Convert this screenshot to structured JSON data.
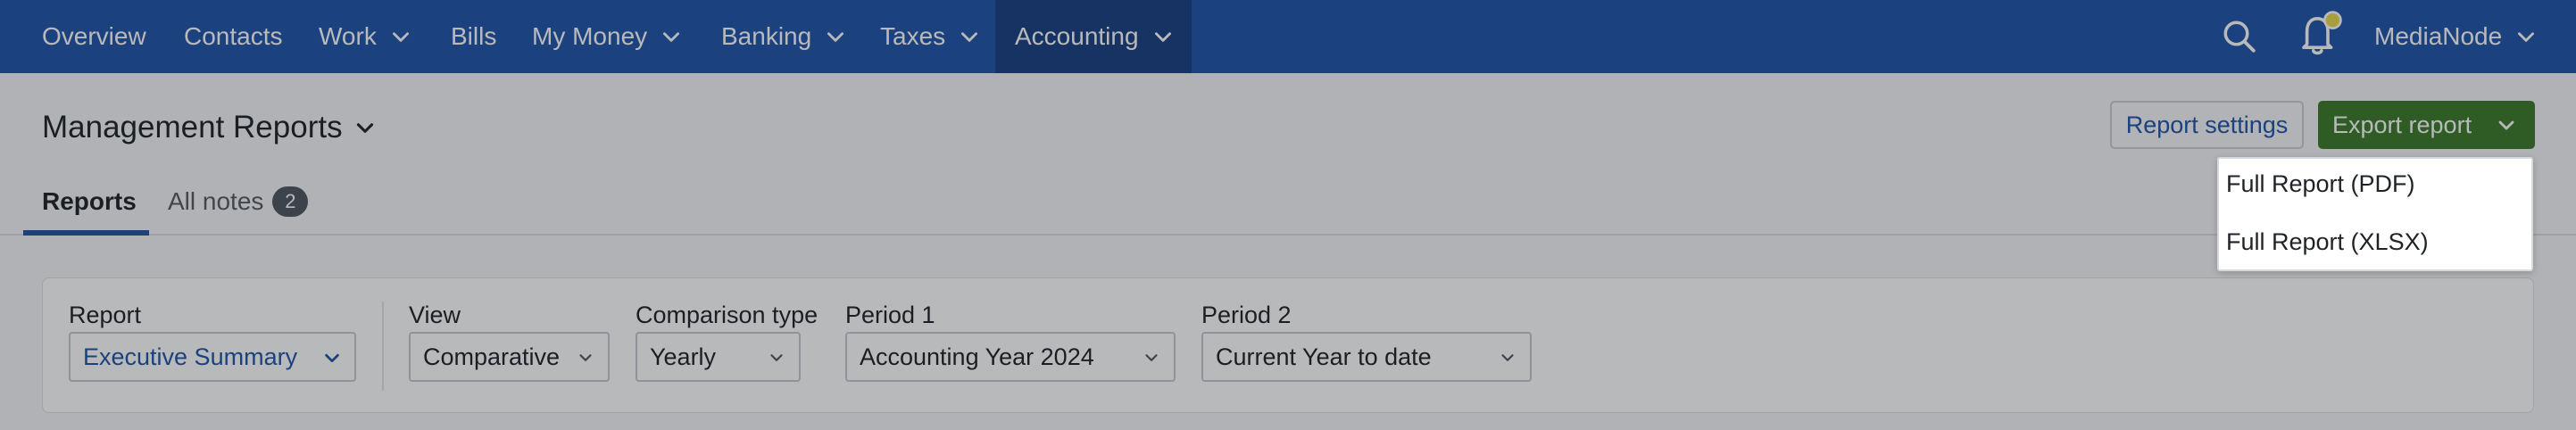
{
  "nav": {
    "items": [
      {
        "label": "Overview"
      },
      {
        "label": "Contacts"
      },
      {
        "label": "Work"
      },
      {
        "label": "Bills"
      },
      {
        "label": "My Money"
      },
      {
        "label": "Banking"
      },
      {
        "label": "Taxes"
      },
      {
        "label": "Accounting"
      }
    ],
    "active": "Accounting",
    "account_label": "MediaNode",
    "icons": [
      "search-icon",
      "bell-icon",
      "notification-dot"
    ]
  },
  "header": {
    "title": "Management Reports",
    "report_settings_label": "Report settings",
    "export_report_label": "Export report"
  },
  "tabs": {
    "reports_label": "Reports",
    "notes_label": "All notes",
    "notes_count": "2"
  },
  "filters": {
    "report": {
      "label": "Report",
      "value": "Executive Summary"
    },
    "view": {
      "label": "View",
      "value": "Comparative"
    },
    "comparison_type": {
      "label": "Comparison type",
      "value": "Yearly"
    },
    "period1": {
      "label": "Period 1",
      "value": "Accounting Year 2024"
    },
    "period2": {
      "label": "Period 2",
      "value": "Current Year to date"
    }
  },
  "export_menu": {
    "items": [
      {
        "label": "Full Report (PDF)"
      },
      {
        "label": "Full Report (XLSX)"
      }
    ]
  },
  "colors": {
    "nav_bg": "#1f55a8",
    "nav_active_bg": "#173f81",
    "export_button": "#3a7a27",
    "link_blue": "#1f55a8"
  }
}
